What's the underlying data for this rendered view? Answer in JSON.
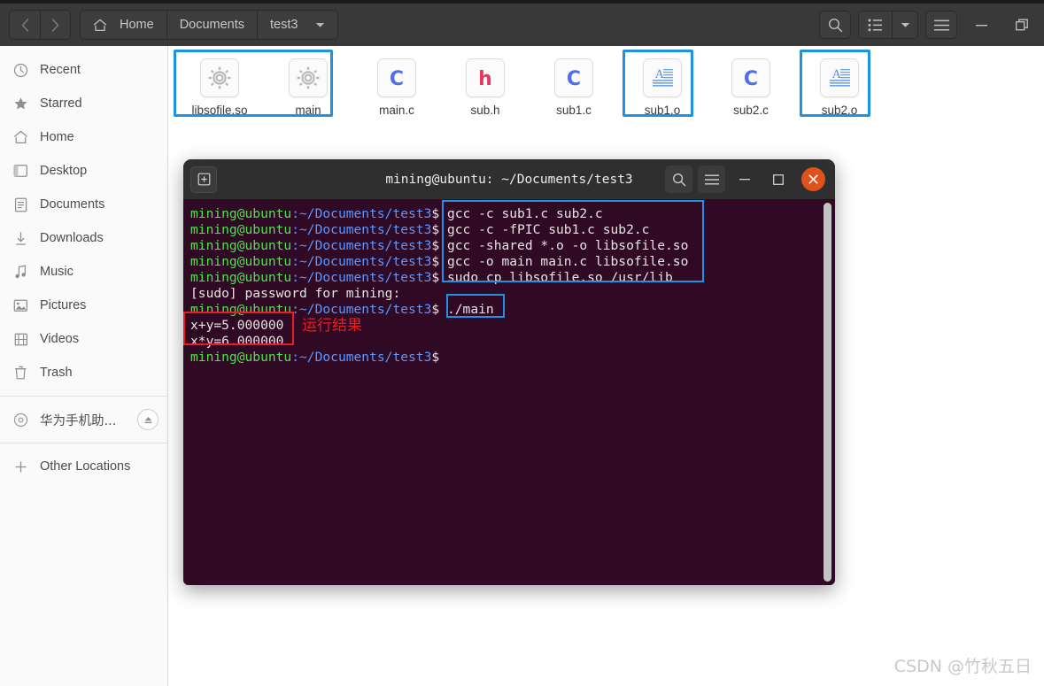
{
  "window": {
    "nav": {
      "back_label": "Back",
      "forward_label": "Forward"
    },
    "breadcrumbs": [
      {
        "label": "Home",
        "icon": "home-icon"
      },
      {
        "label": "Documents",
        "icon": ""
      },
      {
        "label": "test3",
        "icon": "chevron-down-icon"
      }
    ],
    "toolbar": {
      "search": "search-icon",
      "view_list": "list-view-icon",
      "view_dropdown": "chevron-down-icon",
      "menu": "hamburger-menu-icon",
      "minimize": "minimize-icon",
      "maximize": "maximize-icon"
    }
  },
  "sidebar": {
    "items": [
      {
        "label": "Recent",
        "icon": "clock-icon"
      },
      {
        "label": "Starred",
        "icon": "star-icon"
      },
      {
        "label": "Home",
        "icon": "home-icon"
      },
      {
        "label": "Desktop",
        "icon": "desktop-icon"
      },
      {
        "label": "Documents",
        "icon": "document-icon"
      },
      {
        "label": "Downloads",
        "icon": "download-icon"
      },
      {
        "label": "Music",
        "icon": "music-note-icon"
      },
      {
        "label": "Pictures",
        "icon": "picture-icon"
      },
      {
        "label": "Videos",
        "icon": "film-icon"
      },
      {
        "label": "Trash",
        "icon": "trash-icon"
      }
    ],
    "device": {
      "label": "华为手机助...",
      "icon": "disc-icon",
      "eject": "eject-icon"
    },
    "other": {
      "label": "Other Locations",
      "icon": "plus-icon"
    }
  },
  "files": [
    {
      "name": "libsofile.so",
      "icon": "gear-executable-icon",
      "selected": true
    },
    {
      "name": "main",
      "icon": "gear-executable-icon",
      "selected": true
    },
    {
      "name": "main.c",
      "icon": "c-source-icon",
      "selected": false
    },
    {
      "name": "sub.h",
      "icon": "h-header-icon",
      "selected": false
    },
    {
      "name": "sub1.c",
      "icon": "c-source-icon",
      "selected": false
    },
    {
      "name": "sub1.o",
      "icon": "text-object-icon",
      "selected": true
    },
    {
      "name": "sub2.c",
      "icon": "c-source-icon",
      "selected": false
    },
    {
      "name": "sub2.o",
      "icon": "text-object-icon",
      "selected": true
    }
  ],
  "terminal": {
    "title": "mining@ubuntu: ~/Documents/test3",
    "new_tab": "new-tab-icon",
    "search": "search-icon",
    "menu": "hamburger-menu-icon",
    "minimize": "minimize-icon",
    "maximize": "maximize-icon",
    "close": "close-icon",
    "prompt_user": "mining@ubuntu",
    "prompt_path": ":~/Documents/test3",
    "prompt_sigil": "$",
    "lines": [
      {
        "type": "prompt",
        "command": "gcc -c sub1.c sub2.c"
      },
      {
        "type": "prompt",
        "command": "gcc -c -fPIC sub1.c sub2.c"
      },
      {
        "type": "prompt",
        "command": "gcc -shared *.o -o libsofile.so"
      },
      {
        "type": "prompt",
        "command": "gcc -o main main.c libsofile.so"
      },
      {
        "type": "prompt",
        "command": "sudo cp libsofile.so /usr/lib"
      },
      {
        "type": "output",
        "text": "[sudo] password for mining:"
      },
      {
        "type": "prompt",
        "command": "./main"
      },
      {
        "type": "output",
        "text": "x+y=5.000000"
      },
      {
        "type": "output",
        "text": "x*y=6.000000"
      },
      {
        "type": "prompt",
        "command": ""
      }
    ]
  },
  "annotations": {
    "note_text": "运行结果",
    "blue_color": "#1e93e6",
    "red_color": "#ee1b24"
  },
  "watermark": {
    "text": "CSDN @竹秋五日"
  },
  "colors": {
    "header_bg": "#393939",
    "sidebar_bg": "#fafafa",
    "terminal_bg": "#300a24",
    "prompt_green": "#4ee44e",
    "prompt_blue": "#5c97ff",
    "accent_blue": "#1e93e6",
    "accent_red": "#ee1b24",
    "close_orange": "#e0511b"
  }
}
